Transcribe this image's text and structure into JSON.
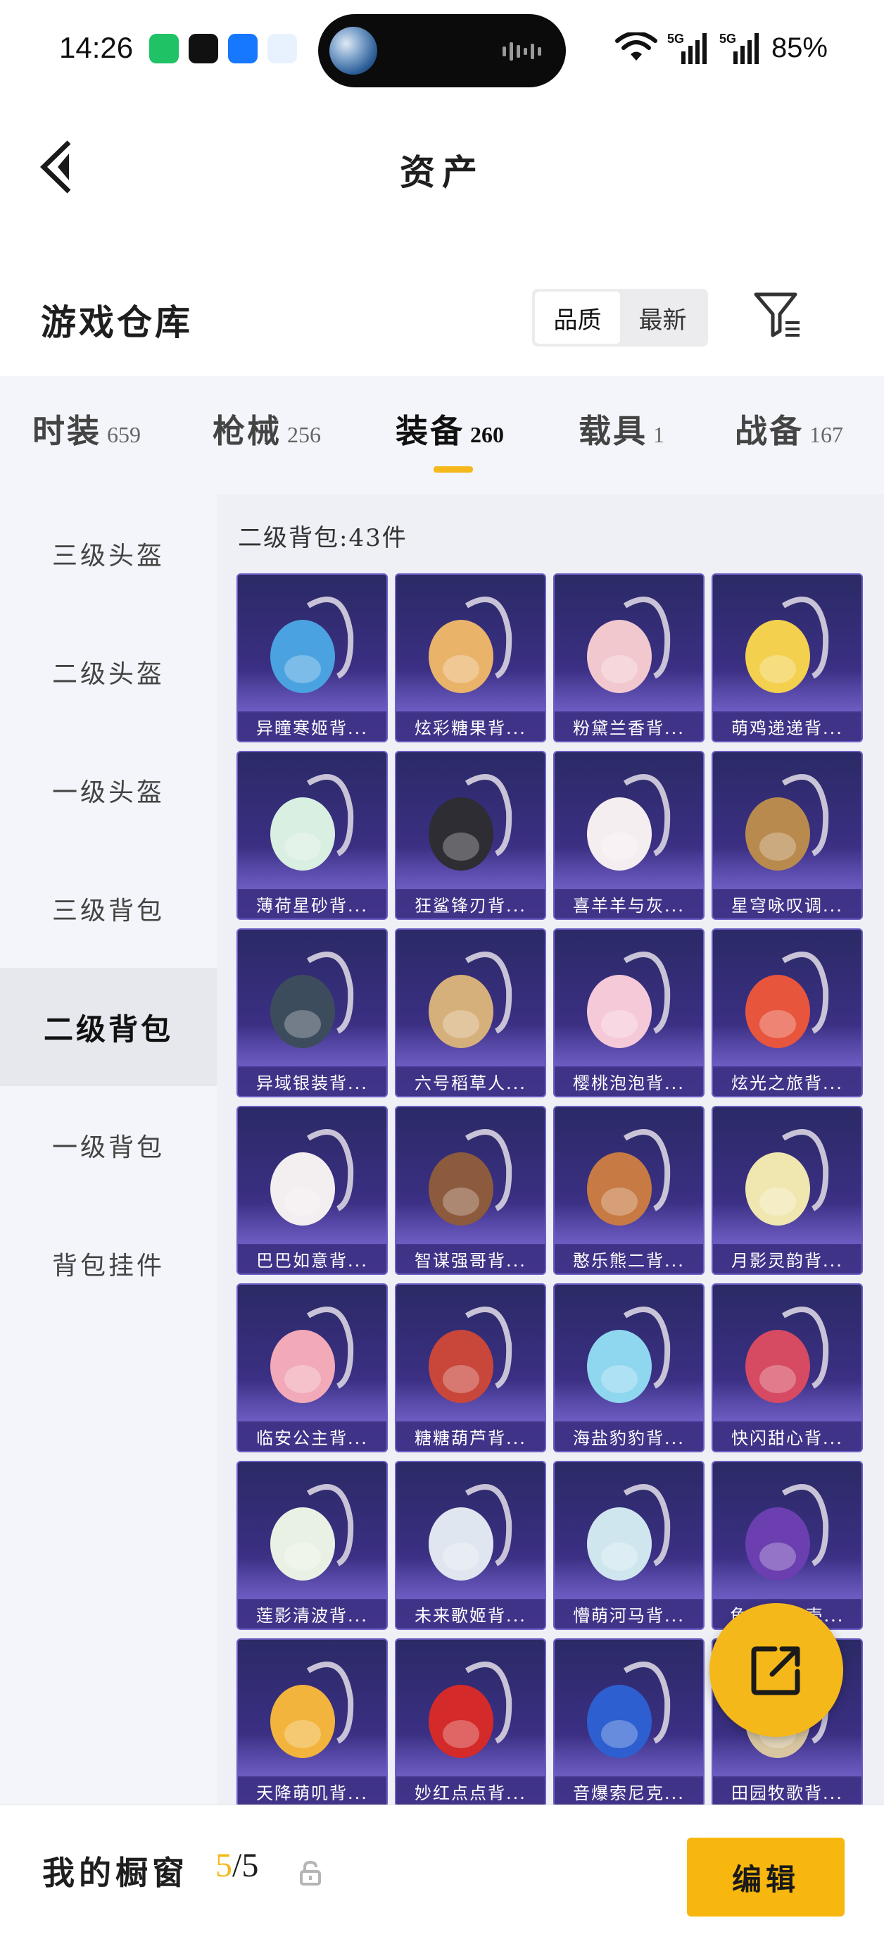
{
  "status_bar": {
    "time": "14:26",
    "battery": "85%",
    "net1": "5G",
    "net2": "5G"
  },
  "header": {
    "title": "资产"
  },
  "warehouse": {
    "title": "游戏仓库",
    "sort_quality": "品质",
    "sort_newest": "最新"
  },
  "tabs": [
    {
      "label": "时装",
      "count": "659"
    },
    {
      "label": "枪械",
      "count": "256"
    },
    {
      "label": "装备",
      "count": "260"
    },
    {
      "label": "载具",
      "count": "1"
    },
    {
      "label": "战备",
      "count": "167"
    }
  ],
  "sidebar": {
    "items": [
      {
        "label": "三级头盔"
      },
      {
        "label": "二级头盔"
      },
      {
        "label": "一级头盔"
      },
      {
        "label": "三级背包"
      },
      {
        "label": "二级背包"
      },
      {
        "label": "一级背包"
      },
      {
        "label": "背包挂件"
      }
    ]
  },
  "content": {
    "count_label": "二级背包:43件"
  },
  "items": [
    {
      "name": "异瞳寒姬背...",
      "color": "#4aa3e0"
    },
    {
      "name": "炫彩糖果背...",
      "color": "#e9b36a"
    },
    {
      "name": "粉黛兰香背...",
      "color": "#f2c8cf"
    },
    {
      "name": "萌鸡递递背...",
      "color": "#f3d04e"
    },
    {
      "name": "薄荷星砂背...",
      "color": "#d8efe2"
    },
    {
      "name": "狂鲨锋刃背...",
      "color": "#2d2d33"
    },
    {
      "name": "喜羊羊与灰...",
      "color": "#f5eef0"
    },
    {
      "name": "星穹咏叹调...",
      "color": "#b98a4e"
    },
    {
      "name": "异域银装背...",
      "color": "#3c4c5c"
    },
    {
      "name": "六号稻草人...",
      "color": "#d6b07a"
    },
    {
      "name": "樱桃泡泡背...",
      "color": "#f6c9d8"
    },
    {
      "name": "炫光之旅背...",
      "color": "#e8553d"
    },
    {
      "name": "巴巴如意背...",
      "color": "#f3eef0"
    },
    {
      "name": "智谋强哥背...",
      "color": "#8c5a3c"
    },
    {
      "name": "憨乐熊二背...",
      "color": "#c77a43"
    },
    {
      "name": "月影灵韵背...",
      "color": "#f0e7b0"
    },
    {
      "name": "临安公主背...",
      "color": "#f2a9b8"
    },
    {
      "name": "糖糖葫芦背...",
      "color": "#c8463a"
    },
    {
      "name": "海盐豹豹背...",
      "color": "#8fd6ef"
    },
    {
      "name": "快闪甜心背...",
      "color": "#d64a62"
    },
    {
      "name": "莲影清波背...",
      "color": "#e9f1e4"
    },
    {
      "name": "未来歌姬背...",
      "color": "#dfe6ef"
    },
    {
      "name": "懵萌河马背...",
      "color": "#cfe6ef"
    },
    {
      "name": "龟仙...背壳...",
      "color": "#6b3fb0"
    },
    {
      "name": "天降萌叽背...",
      "color": "#f2b43c"
    },
    {
      "name": "妙红点点背...",
      "color": "#d42a2a"
    },
    {
      "name": "音爆索尼克...",
      "color": "#2d5fd0"
    },
    {
      "name": "田园牧歌背...",
      "color": "#d8c6a0"
    }
  ],
  "bottom": {
    "label": "我的橱窗",
    "current": "5",
    "total": "/5",
    "edit": "编辑"
  }
}
